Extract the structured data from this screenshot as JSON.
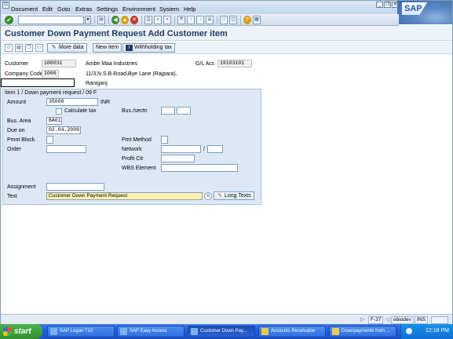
{
  "menubar": {
    "items": [
      {
        "label": "Document",
        "u": "D"
      },
      {
        "label": "Edit",
        "u": "E"
      },
      {
        "label": "Goto",
        "u": "G"
      },
      {
        "label": "Extras",
        "u": "x"
      },
      {
        "label": "Settings",
        "u": "S"
      },
      {
        "label": "Environment",
        "u": "n"
      },
      {
        "label": "System",
        "u": "y"
      },
      {
        "label": "Help",
        "u": "H"
      }
    ],
    "logo_text": "SAP"
  },
  "toolbar": {
    "command_field_value": "",
    "icons": [
      "enter-icon",
      "save-icon",
      "back-icon",
      "exit-icon",
      "cancel-icon",
      "print-icon",
      "find-icon",
      "find-next-icon",
      "first-page-icon",
      "previous-page-icon",
      "next-page-icon",
      "last-page-icon",
      "new-session-icon",
      "shortcut-icon",
      "help-icon",
      "customize-layout-icon"
    ]
  },
  "title": "Customer Down Payment Request Add Customer item",
  "app_toolbar": {
    "more_data_label": "More data",
    "new_item_label": "New item",
    "withholding_tax_label": "Withholding tax"
  },
  "header": {
    "customer_label": "Customer",
    "customer_value": "100031",
    "company_code_label": "Company Code",
    "company_code_value": "1000",
    "name": "Ambe Maa Industries",
    "address_line": "11/3,N.S.B.Road,Bye Lane (Rajpara),",
    "city": "Raniganj",
    "gl_acc_label": "G/L Acc",
    "gl_acc_value": "19103101"
  },
  "item": {
    "header": "Item 1 / Down payment request / 09 F",
    "amount_label": "Amount",
    "amount_value": "35000",
    "currency": "INR",
    "calculate_tax_label": "Calculate tax",
    "bus_sectn_label": "Bus./sectn",
    "bus_area_label": "Bus. Area",
    "bus_area_value": "BA01",
    "due_on_label": "Due on",
    "due_on_value": "02.04.2009",
    "pmnt_block_label": "Pmnt Block",
    "pmnt_method_label": "Pmt Method",
    "order_label": "Order",
    "network_label": "Network",
    "network_separator": "/",
    "profit_ctr_label": "Profit Ctr",
    "wbs_element_label": "WBS Element",
    "assignment_label": "Assignment",
    "text_label": "Text",
    "text_value": "Customer Down Payment Request",
    "long_texts_label": "Long Texts"
  },
  "statusbar": {
    "transaction": "F-37",
    "server": "ebiodev",
    "mode": "INS"
  },
  "taskbar": {
    "start_label": "start",
    "tasks": [
      {
        "label": "SAP Logon 710",
        "icon": "sap"
      },
      {
        "label": "SAP Easy Access",
        "icon": "sap"
      },
      {
        "label": "Customer Down Pay...",
        "icon": "sap",
        "active": true
      },
      {
        "label": "Accounts Receivable",
        "icon": "folder"
      },
      {
        "label": "Downpayments from ...",
        "icon": "folder"
      }
    ],
    "clock": "12:18 PM"
  }
}
